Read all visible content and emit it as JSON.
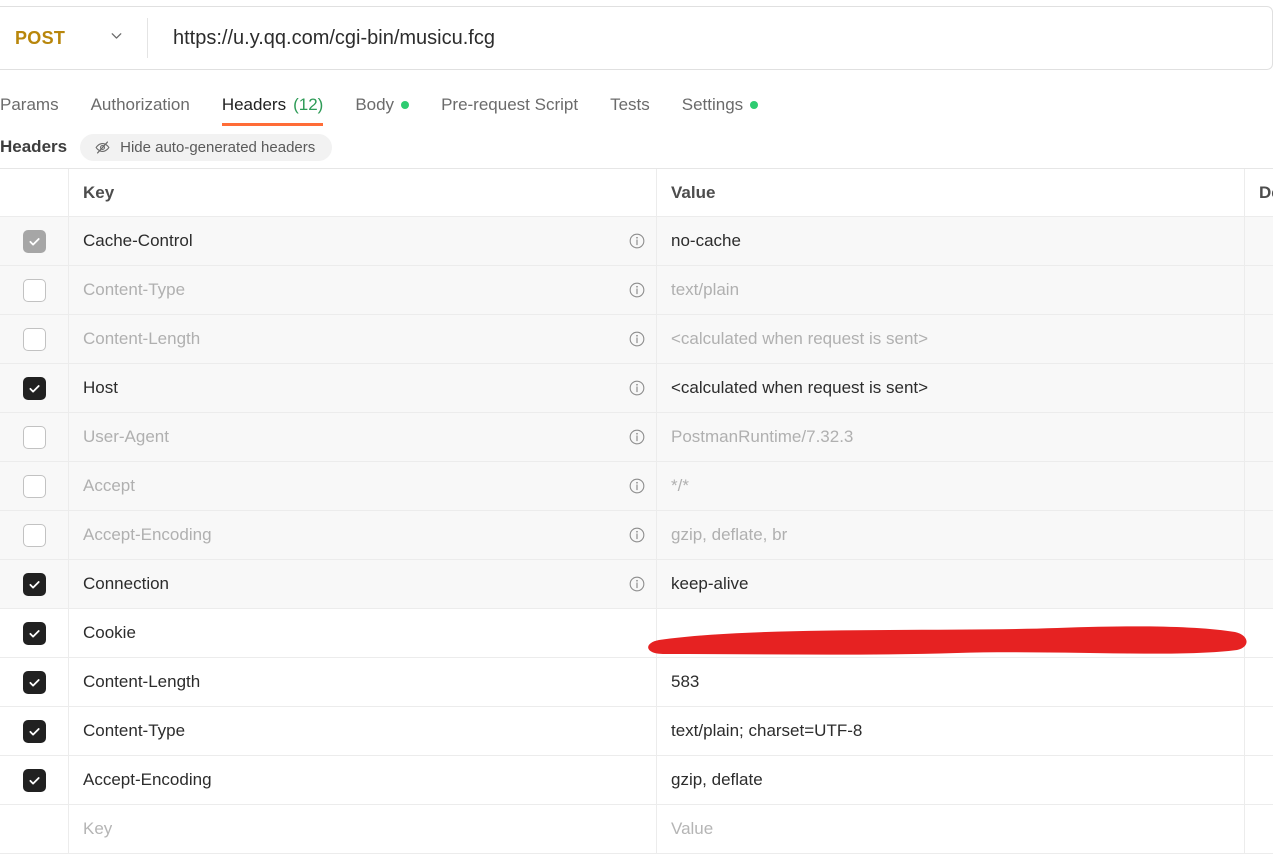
{
  "request": {
    "method": "POST",
    "method_caret_icon": "chevron-down-icon",
    "url": "https://u.y.qq.com/cgi-bin/musicu.fcg"
  },
  "tabs": [
    {
      "label": "Params",
      "active": false,
      "badge": "",
      "dot": false
    },
    {
      "label": "Authorization",
      "active": false,
      "badge": "",
      "dot": false
    },
    {
      "label": "Headers",
      "active": true,
      "badge": "(12)",
      "dot": false
    },
    {
      "label": "Body",
      "active": false,
      "badge": "",
      "dot": true
    },
    {
      "label": "Pre-request Script",
      "active": false,
      "badge": "",
      "dot": false
    },
    {
      "label": "Tests",
      "active": false,
      "badge": "",
      "dot": false
    },
    {
      "label": "Settings",
      "active": false,
      "badge": "",
      "dot": true
    }
  ],
  "subheader": {
    "title": "Headers",
    "hide_button_label": "Hide auto-generated headers",
    "hide_button_icon": "eye-slash-icon"
  },
  "table": {
    "columns": {
      "key": "Key",
      "value": "Value",
      "description": "De"
    },
    "rows": [
      {
        "checked": "dim",
        "key": "Cache-Control",
        "value": "no-cache",
        "info": true,
        "auto": true,
        "muted": false
      },
      {
        "checked": "off",
        "key": "Content-Type",
        "value": "text/plain",
        "info": true,
        "auto": true,
        "muted": true
      },
      {
        "checked": "off",
        "key": "Content-Length",
        "value": "<calculated when request is sent>",
        "info": true,
        "auto": true,
        "muted": true
      },
      {
        "checked": "on",
        "key": "Host",
        "value": "<calculated when request is sent>",
        "info": true,
        "auto": true,
        "muted": false
      },
      {
        "checked": "off",
        "key": "User-Agent",
        "value": "PostmanRuntime/7.32.3",
        "info": true,
        "auto": true,
        "muted": true
      },
      {
        "checked": "off",
        "key": "Accept",
        "value": "*/*",
        "info": true,
        "auto": true,
        "muted": true
      },
      {
        "checked": "off",
        "key": "Accept-Encoding",
        "value": "gzip, deflate, br",
        "info": true,
        "auto": true,
        "muted": true
      },
      {
        "checked": "on",
        "key": "Connection",
        "value": "keep-alive",
        "info": true,
        "auto": true,
        "muted": false
      },
      {
        "checked": "on",
        "key": "Cookie",
        "value": "",
        "info": false,
        "auto": false,
        "muted": false
      },
      {
        "checked": "on",
        "key": "Content-Length",
        "value": "583",
        "info": false,
        "auto": false,
        "muted": false
      },
      {
        "checked": "on",
        "key": "Content-Type",
        "value": "text/plain; charset=UTF-8",
        "info": false,
        "auto": false,
        "muted": false
      },
      {
        "checked": "on",
        "key": "Accept-Encoding",
        "value": "gzip, deflate",
        "info": false,
        "auto": false,
        "muted": false
      }
    ],
    "new_row": {
      "key_placeholder": "Key",
      "value_placeholder": "Value",
      "description_placeholder": "De"
    }
  },
  "annotation": {
    "type": "redaction-stroke",
    "color": "#e62222",
    "covers": "cookie-value"
  },
  "colors": {
    "accent": "#ff6c37",
    "method": "#b8860b",
    "count": "#2e9b57",
    "dot": "#2ecc71",
    "checkbox_on": "#212121",
    "checkbox_dim": "#a6a6a6",
    "redaction": "#e62222"
  }
}
